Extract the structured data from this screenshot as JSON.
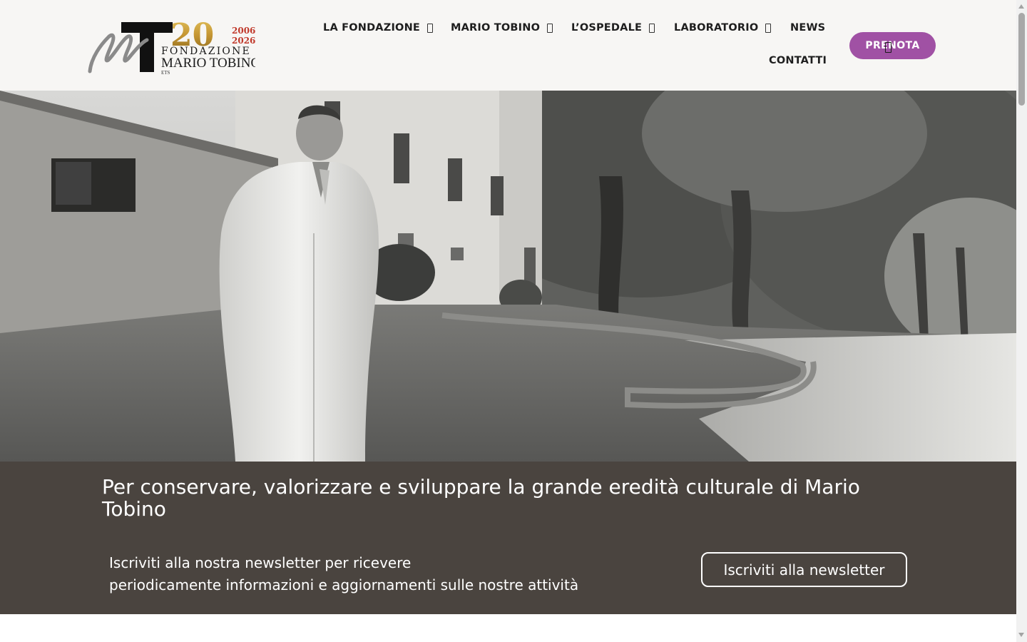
{
  "logo": {
    "mark_letter": "T",
    "script_letter": "M",
    "anniversary": "20",
    "year_start": "2006",
    "year_end": "2026",
    "line1": "FONDAZIONE",
    "line2": "MARIO TOBINO",
    "suffix": "ETS"
  },
  "nav": {
    "items": [
      {
        "label": "LA FONDAZIONE",
        "dropdown": true
      },
      {
        "label": "MARIO TOBINO",
        "dropdown": true
      },
      {
        "label": "L’OSPEDALE",
        "dropdown": true
      },
      {
        "label": "LABORATORIO",
        "dropdown": true
      },
      {
        "label": "NEWS",
        "dropdown": false
      },
      {
        "label": "CONTATTI",
        "dropdown": false
      }
    ],
    "cta_label": "PRENOTA"
  },
  "hero": {
    "image": "black-and-white-photo-doctor-in-white-coat-outside-hospital"
  },
  "banner": {
    "title": "Per conservare, valorizzare e sviluppare la grande eredità culturale di Mario Tobino",
    "newsletter_line1": "Iscriviti alla nostra newsletter per ricevere",
    "newsletter_line2": "periodicamente informazioni e aggiornamenti sulle nostre attività",
    "newsletter_button": "Iscriviti alla newsletter"
  },
  "colors": {
    "header_bg": "#f7f6f4",
    "accent": "#a051a4",
    "banner_bg": "#4a443f",
    "logo_gold": "#c9a13b",
    "logo_red": "#c0392b"
  },
  "icons": {
    "dropdown": "chevron-down-icon"
  }
}
